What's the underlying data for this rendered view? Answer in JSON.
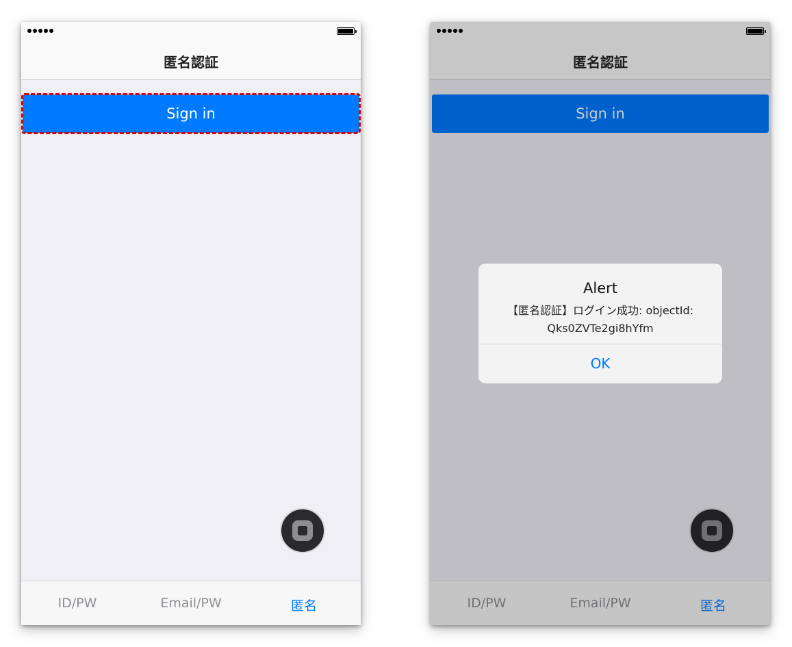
{
  "screens": [
    {
      "nav_title": "匿名認証",
      "button_label": "Sign in",
      "tabs": [
        "ID/PW",
        "Email/PW",
        "匿名"
      ]
    },
    {
      "nav_title": "匿名認証",
      "button_label": "Sign in",
      "tabs": [
        "ID/PW",
        "Email/PW",
        "匿名"
      ],
      "alert": {
        "title": "Alert",
        "message_line1": "【匿名認証】ログイン成功: objectId:",
        "message_line2": "Qks0ZVTe2gi8hYfm",
        "ok": "OK"
      }
    }
  ],
  "colors": {
    "accent": "#007aff",
    "highlight_outline": "#e00000",
    "alert_background": "#f3f3f3"
  },
  "icons": {
    "status_signal": "signal-dots-icon",
    "status_battery": "battery-icon",
    "assistive_touch": "assistive-touch-icon"
  }
}
